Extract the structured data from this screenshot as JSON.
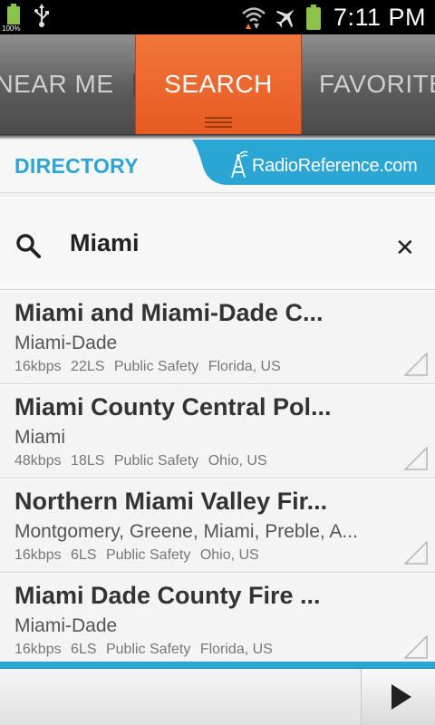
{
  "status_bar": {
    "battery_small_pct": "100%",
    "time": "7:11 PM",
    "icons": [
      "battery-icon",
      "usb-icon",
      "wifi-icon",
      "airplane-mode-icon",
      "battery-icon"
    ]
  },
  "tabs": [
    {
      "label": "NEAR ME",
      "selected": false
    },
    {
      "label": "SEARCH",
      "selected": true
    },
    {
      "label": "FAVORITES",
      "selected": false
    }
  ],
  "directory": {
    "title": "DIRECTORY",
    "logo_text": "RadioReference.com"
  },
  "search": {
    "value": "Miami",
    "placeholder": "",
    "clear_symbol": "✕"
  },
  "results": [
    {
      "name": "Miami and Miami-Dade C...",
      "county": "Miami-Dade",
      "bitrate": "16kbps",
      "listeners": "22LS",
      "genre": "Public Safety",
      "location": "Florida, US"
    },
    {
      "name": "Miami County Central Pol...",
      "county": "Miami",
      "bitrate": "48kbps",
      "listeners": "18LS",
      "genre": "Public Safety",
      "location": "Ohio, US"
    },
    {
      "name": "Northern Miami Valley Fir...",
      "county": "Montgomery, Greene, Miami, Preble, A...",
      "bitrate": "16kbps",
      "listeners": "6LS",
      "genre": "Public Safety",
      "location": "Ohio, US"
    },
    {
      "name": "Miami Dade County Fire ...",
      "county": "Miami-Dade",
      "bitrate": "16kbps",
      "listeners": "6LS",
      "genre": "Public Safety",
      "location": "Florida, US"
    }
  ],
  "player": {
    "play_icon": "play-icon"
  },
  "colors": {
    "accent_orange": "#e85a21",
    "accent_blue": "#2aa5d4",
    "battery_green": "#8bc34a"
  }
}
